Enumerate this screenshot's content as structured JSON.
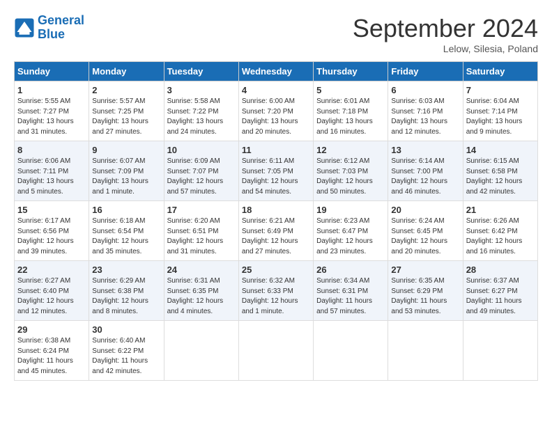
{
  "header": {
    "logo_line1": "General",
    "logo_line2": "Blue",
    "month": "September 2024",
    "location": "Lelow, Silesia, Poland"
  },
  "weekdays": [
    "Sunday",
    "Monday",
    "Tuesday",
    "Wednesday",
    "Thursday",
    "Friday",
    "Saturday"
  ],
  "weeks": [
    [
      {
        "day": "1",
        "info": "Sunrise: 5:55 AM\nSunset: 7:27 PM\nDaylight: 13 hours\nand 31 minutes."
      },
      {
        "day": "2",
        "info": "Sunrise: 5:57 AM\nSunset: 7:25 PM\nDaylight: 13 hours\nand 27 minutes."
      },
      {
        "day": "3",
        "info": "Sunrise: 5:58 AM\nSunset: 7:22 PM\nDaylight: 13 hours\nand 24 minutes."
      },
      {
        "day": "4",
        "info": "Sunrise: 6:00 AM\nSunset: 7:20 PM\nDaylight: 13 hours\nand 20 minutes."
      },
      {
        "day": "5",
        "info": "Sunrise: 6:01 AM\nSunset: 7:18 PM\nDaylight: 13 hours\nand 16 minutes."
      },
      {
        "day": "6",
        "info": "Sunrise: 6:03 AM\nSunset: 7:16 PM\nDaylight: 13 hours\nand 12 minutes."
      },
      {
        "day": "7",
        "info": "Sunrise: 6:04 AM\nSunset: 7:14 PM\nDaylight: 13 hours\nand 9 minutes."
      }
    ],
    [
      {
        "day": "8",
        "info": "Sunrise: 6:06 AM\nSunset: 7:11 PM\nDaylight: 13 hours\nand 5 minutes."
      },
      {
        "day": "9",
        "info": "Sunrise: 6:07 AM\nSunset: 7:09 PM\nDaylight: 13 hours\nand 1 minute."
      },
      {
        "day": "10",
        "info": "Sunrise: 6:09 AM\nSunset: 7:07 PM\nDaylight: 12 hours\nand 57 minutes."
      },
      {
        "day": "11",
        "info": "Sunrise: 6:11 AM\nSunset: 7:05 PM\nDaylight: 12 hours\nand 54 minutes."
      },
      {
        "day": "12",
        "info": "Sunrise: 6:12 AM\nSunset: 7:03 PM\nDaylight: 12 hours\nand 50 minutes."
      },
      {
        "day": "13",
        "info": "Sunrise: 6:14 AM\nSunset: 7:00 PM\nDaylight: 12 hours\nand 46 minutes."
      },
      {
        "day": "14",
        "info": "Sunrise: 6:15 AM\nSunset: 6:58 PM\nDaylight: 12 hours\nand 42 minutes."
      }
    ],
    [
      {
        "day": "15",
        "info": "Sunrise: 6:17 AM\nSunset: 6:56 PM\nDaylight: 12 hours\nand 39 minutes."
      },
      {
        "day": "16",
        "info": "Sunrise: 6:18 AM\nSunset: 6:54 PM\nDaylight: 12 hours\nand 35 minutes."
      },
      {
        "day": "17",
        "info": "Sunrise: 6:20 AM\nSunset: 6:51 PM\nDaylight: 12 hours\nand 31 minutes."
      },
      {
        "day": "18",
        "info": "Sunrise: 6:21 AM\nSunset: 6:49 PM\nDaylight: 12 hours\nand 27 minutes."
      },
      {
        "day": "19",
        "info": "Sunrise: 6:23 AM\nSunset: 6:47 PM\nDaylight: 12 hours\nand 23 minutes."
      },
      {
        "day": "20",
        "info": "Sunrise: 6:24 AM\nSunset: 6:45 PM\nDaylight: 12 hours\nand 20 minutes."
      },
      {
        "day": "21",
        "info": "Sunrise: 6:26 AM\nSunset: 6:42 PM\nDaylight: 12 hours\nand 16 minutes."
      }
    ],
    [
      {
        "day": "22",
        "info": "Sunrise: 6:27 AM\nSunset: 6:40 PM\nDaylight: 12 hours\nand 12 minutes."
      },
      {
        "day": "23",
        "info": "Sunrise: 6:29 AM\nSunset: 6:38 PM\nDaylight: 12 hours\nand 8 minutes."
      },
      {
        "day": "24",
        "info": "Sunrise: 6:31 AM\nSunset: 6:35 PM\nDaylight: 12 hours\nand 4 minutes."
      },
      {
        "day": "25",
        "info": "Sunrise: 6:32 AM\nSunset: 6:33 PM\nDaylight: 12 hours\nand 1 minute."
      },
      {
        "day": "26",
        "info": "Sunrise: 6:34 AM\nSunset: 6:31 PM\nDaylight: 11 hours\nand 57 minutes."
      },
      {
        "day": "27",
        "info": "Sunrise: 6:35 AM\nSunset: 6:29 PM\nDaylight: 11 hours\nand 53 minutes."
      },
      {
        "day": "28",
        "info": "Sunrise: 6:37 AM\nSunset: 6:27 PM\nDaylight: 11 hours\nand 49 minutes."
      }
    ],
    [
      {
        "day": "29",
        "info": "Sunrise: 6:38 AM\nSunset: 6:24 PM\nDaylight: 11 hours\nand 45 minutes."
      },
      {
        "day": "30",
        "info": "Sunrise: 6:40 AM\nSunset: 6:22 PM\nDaylight: 11 hours\nand 42 minutes."
      },
      null,
      null,
      null,
      null,
      null
    ]
  ]
}
